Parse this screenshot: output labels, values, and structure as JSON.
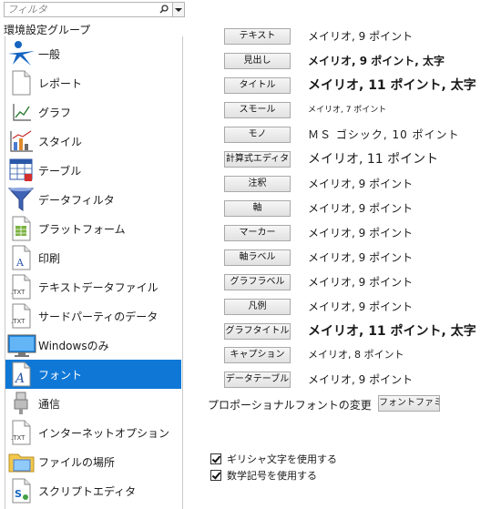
{
  "filter": {
    "placeholder": "フィルタ"
  },
  "group_label": "環境設定グループ",
  "sidebar": {
    "items": [
      {
        "label": "一般",
        "icon": "general-icon"
      },
      {
        "label": "レポート",
        "icon": "report-icon"
      },
      {
        "label": "グラフ",
        "icon": "graph-icon"
      },
      {
        "label": "スタイル",
        "icon": "style-icon"
      },
      {
        "label": "テーブル",
        "icon": "table-icon"
      },
      {
        "label": "データフィルタ",
        "icon": "funnel-icon"
      },
      {
        "label": "プラットフォーム",
        "icon": "platform-icon"
      },
      {
        "label": "印刷",
        "icon": "print-icon"
      },
      {
        "label": "テキストデータファイル",
        "icon": "txt-file-icon"
      },
      {
        "label": "サードパーティのデータ",
        "icon": "txt-file-icon"
      },
      {
        "label": "Windowsのみ",
        "icon": "monitor-icon"
      },
      {
        "label": "フォント",
        "icon": "font-icon",
        "selected": true
      },
      {
        "label": "通信",
        "icon": "communication-icon"
      },
      {
        "label": "インターネットオプション",
        "icon": "txt-file-icon"
      },
      {
        "label": "ファイルの場所",
        "icon": "folder-icon"
      },
      {
        "label": "スクリプトエディタ",
        "icon": "script-icon"
      }
    ]
  },
  "fonts": {
    "rows": [
      {
        "button": "テキスト",
        "sample": "メイリオ, 9 ポイント"
      },
      {
        "button": "見出し",
        "sample": "メイリオ, 9 ポイント, 太字"
      },
      {
        "button": "タイトル",
        "sample": "メイリオ, 11 ポイント, 太字"
      },
      {
        "button": "スモール",
        "sample": "メイリオ, 7 ポイント"
      },
      {
        "button": "モノ",
        "sample": "ＭＳ ゴシック, 10 ポイント"
      },
      {
        "button": "計算式エディタ",
        "sample": "メイリオ, 11 ポイント"
      },
      {
        "button": "注釈",
        "sample": "メイリオ, 9 ポイント"
      },
      {
        "button": "軸",
        "sample": "メイリオ, 9 ポイント"
      },
      {
        "button": "マーカー",
        "sample": "メイリオ, 9 ポイント"
      },
      {
        "button": "軸ラベル",
        "sample": "メイリオ, 9 ポイント"
      },
      {
        "button": "グラフラベル",
        "sample": "メイリオ, 9 ポイント"
      },
      {
        "button": "凡例",
        "sample": "メイリオ, 9 ポイント"
      },
      {
        "button": "グラフタイトル",
        "sample": "メイリオ, 11 ポイント, 太字"
      },
      {
        "button": "キャプション",
        "sample": "メイリオ, 8 ポイント"
      },
      {
        "button": "データテーブル",
        "sample": "メイリオ, 9 ポイント"
      }
    ],
    "proportional_label": "プロポーショナルフォントの変更",
    "font_family_button": "フォントファミリ"
  },
  "options": {
    "greek_label": "ギリシャ文字を使用する",
    "greek_checked": true,
    "math_label": "数学記号を使用する",
    "math_checked": true
  }
}
